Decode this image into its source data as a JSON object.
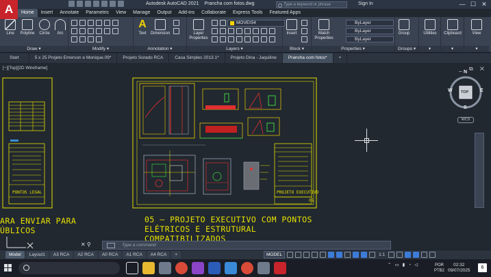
{
  "app": {
    "logo": "A",
    "title": "Autodesk AutoCAD 2021",
    "file": "Prancha com fotos.dwg",
    "search_placeholder": "Type a keyword or phrase",
    "sign_in": "Sign In",
    "minimize": "—",
    "restore": "☐",
    "close": "✕"
  },
  "ribbon_tabs": [
    "Home",
    "Insert",
    "Annotate",
    "Parametric",
    "View",
    "Manage",
    "Output",
    "Add-ins",
    "Collaborate",
    "Express Tools",
    "Featured Apps"
  ],
  "ribbon": {
    "draw": {
      "label": "Draw ▾",
      "line": "Line",
      "polyline": "Polyline",
      "circle": "Circle",
      "arc": "Arc"
    },
    "modify": {
      "label": "Modify ▾"
    },
    "annotation": {
      "label": "Annotation ▾",
      "text": "Text",
      "dimension": "Dimension"
    },
    "layers": {
      "label": "Layers ▾",
      "layer_properties": "Layer Properties",
      "current_layer": "MOVEIS4"
    },
    "block": {
      "label": "Block ▾",
      "insert": "Insert"
    },
    "properties": {
      "label": "Properties ▾",
      "match": "Match Properties",
      "color": "ByLayer",
      "linetype": "ByLayer",
      "lineweight": "ByLayer"
    },
    "groups": {
      "label": "Groups ▾",
      "group": "Group"
    },
    "utilities": "Utilities",
    "clipboard": "Clipboard",
    "view": "View"
  },
  "doc_tabs": [
    "Start",
    "5 x 25 Projeto Emerson e Monique.09*",
    "Projeto Sorado RCA",
    "Casa Simples 2013.1*",
    "Projeto Dina - Jaquiline",
    "Prancha com fotos*"
  ],
  "viewport": {
    "label": "[−][Top][2D Wireframe]",
    "controls": "_ ⧉ ✕",
    "wcs": "WCS",
    "cube_top": "TOP",
    "cube_n": "N",
    "cube_s": "S",
    "cube_e": "E",
    "cube_w": "W"
  },
  "drawing": {
    "left_sheet_title": "PONTOS LEGAL",
    "right_sheet_title": "PROJETO EXECUTIVO",
    "left_big_text_1": "ARA ENVIAR PARA",
    "left_big_text_2": "ÚBLICOS",
    "right_big_text_1": "05 — PROJETO EXECUTIVO COM PONTOS",
    "right_big_text_2": "ELÉTRICOS E ESTRUTURAL",
    "right_big_text_3": "COMPATIBILIZADOS",
    "sheet_number": "05"
  },
  "command": {
    "prompt": "Type a command"
  },
  "layout_tabs": [
    "Model",
    "Layout1",
    "A3 RCA",
    "A2 RCA",
    "A0 RCA",
    "A1 RCA",
    "A4 RCA",
    "+"
  ],
  "status": {
    "model": "MODEL",
    "scale": "1:1"
  },
  "taskbar": {
    "lang_1": "POR",
    "lang_2": "PTB2",
    "time": "02:32",
    "date": "09/07/2025",
    "notifications": "6"
  }
}
